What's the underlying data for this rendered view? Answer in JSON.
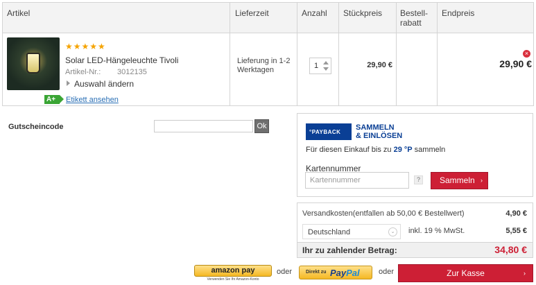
{
  "cart": {
    "headers": {
      "artikel": "Artikel",
      "lieferzeit": "Lieferzeit",
      "anzahl": "Anzahl",
      "stueckpreis": "Stückpreis",
      "bestellrabatt_1": "Bestell-",
      "bestellrabatt_2": "rabatt",
      "endpreis": "Endpreis"
    },
    "item": {
      "stars": "★★★★★",
      "rating": 5,
      "name": "Solar LED-Hängeleuchte Tivoli",
      "article_no_label": "Artikel-Nr.:",
      "article_no": "3012135",
      "change_label": "Auswahl ändern",
      "energy_class": "A+",
      "label_link": "Etikett ansehen",
      "delivery": "Lieferung in 1-2 Werktagen",
      "quantity": "1",
      "unit_price": "29,90 €",
      "end_price": "29,90 €",
      "remove_symbol": "×"
    }
  },
  "coupon": {
    "label": "Gutscheincode",
    "value": "",
    "ok_label": "Ok"
  },
  "payback": {
    "logo_text": "°PAYBACK",
    "title_1": "SAMMELN",
    "title_2": "& EINLÖSEN",
    "text_before": "Für diesen Einkauf bis zu",
    "points": "29 °P",
    "text_after": "sammeln",
    "card_label": "Kartennummer",
    "card_placeholder": "Kartennummer",
    "help": "?",
    "button": "Sammeln",
    "button_chevron": "›"
  },
  "totals": {
    "shipping_label": "Versandkosten(entfallen ab 50,00 € Bestellwert)",
    "shipping_value": "4,90 €",
    "country": "Deutschland",
    "dropdown_icon": "⌄",
    "vat_label": "inkl. 19 % MwSt.",
    "vat_value": "5,55 €",
    "sum_label": "Ihr zu zahlender Betrag:",
    "sum_value": "34,80 €"
  },
  "checkout": {
    "amazon_label": "amazon pay",
    "amazon_sub": "Verwenden Sie Ihr Amazon-Konto",
    "or_1": "oder",
    "paypal_small": "Direkt zu",
    "paypal_1": "Pay",
    "paypal_2": "Pal",
    "or_2": "oder",
    "checkout_label": "Zur Kasse",
    "checkout_chevron": "›"
  },
  "colors": {
    "accent": "#cd1f35",
    "payback_blue": "#0a3f95",
    "link": "#2a6fb5",
    "energy_green": "#3aa534",
    "star": "#f5a300"
  }
}
